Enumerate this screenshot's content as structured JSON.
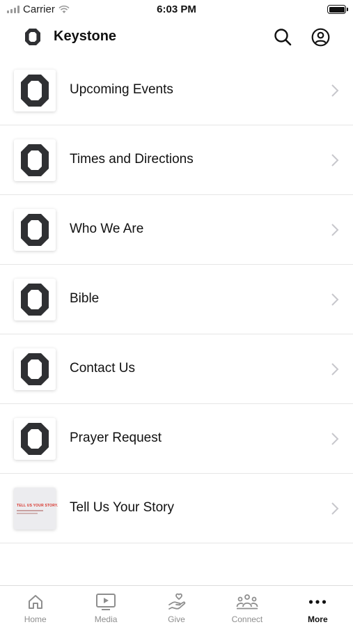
{
  "status_bar": {
    "carrier": "Carrier",
    "time": "6:03 PM"
  },
  "header": {
    "title": "Keystone",
    "logo_icon": "keystone-logo-icon",
    "search_icon": "search-icon",
    "profile_icon": "profile-icon"
  },
  "menu": {
    "items": [
      {
        "label": "Upcoming Events",
        "thumb": "keystone-logo"
      },
      {
        "label": "Times and Directions",
        "thumb": "keystone-logo"
      },
      {
        "label": "Who We Are",
        "thumb": "keystone-logo"
      },
      {
        "label": "Bible",
        "thumb": "keystone-logo"
      },
      {
        "label": "Contact Us",
        "thumb": "keystone-logo"
      },
      {
        "label": "Prayer Request",
        "thumb": "keystone-logo"
      },
      {
        "label": "Tell Us Your Story",
        "thumb": "tell-us-your-story-image",
        "thumb_text": "TELL US YOUR STORY."
      }
    ]
  },
  "tab_bar": {
    "tabs": [
      {
        "label": "Home",
        "icon": "home-icon",
        "active": false
      },
      {
        "label": "Media",
        "icon": "media-icon",
        "active": false
      },
      {
        "label": "Give",
        "icon": "give-icon",
        "active": false
      },
      {
        "label": "Connect",
        "icon": "connect-icon",
        "active": false
      },
      {
        "label": "More",
        "icon": "more-icon",
        "active": true
      }
    ]
  },
  "colors": {
    "logo": "#2f3033",
    "text": "#111111",
    "inactive_tab": "#8e8e8e",
    "divider": "#e6e6e6",
    "chevron": "#c7c7cc",
    "story_red": "#d8332a"
  }
}
